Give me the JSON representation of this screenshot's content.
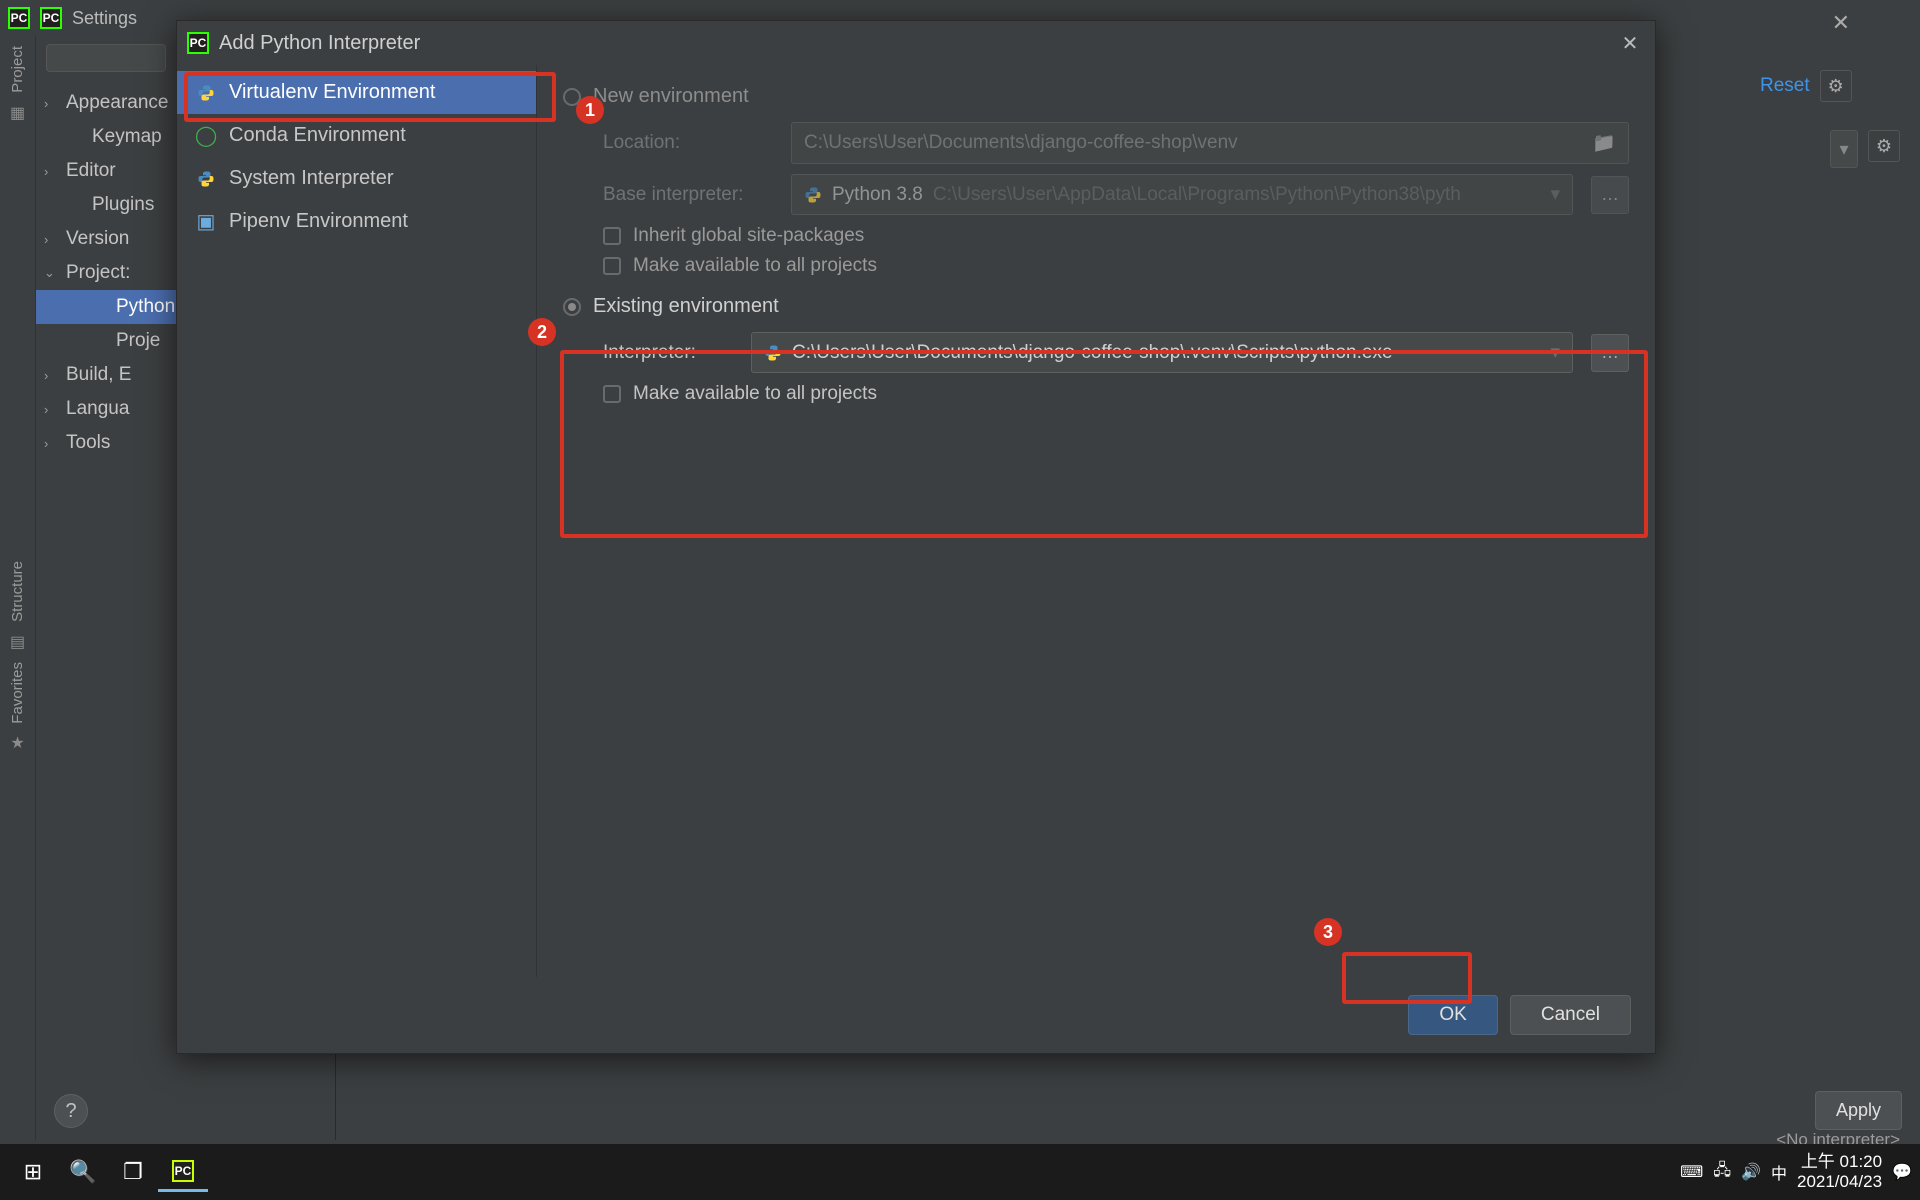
{
  "ide": {
    "titlebar_settings": "Settings",
    "reset": "Reset",
    "apply": "Apply",
    "no_interpreter": "<No interpreter>",
    "search_placeholder": ""
  },
  "settings_tree": {
    "items": [
      {
        "label": "Appearance",
        "chevron": ">"
      },
      {
        "label": "Keymap",
        "chevron": ""
      },
      {
        "label": "Editor",
        "chevron": ">"
      },
      {
        "label": "Plugins",
        "chevron": ""
      },
      {
        "label": "Version",
        "chevron": ">"
      },
      {
        "label": "Project:",
        "chevron": "v"
      },
      {
        "label": "Python",
        "chevron": "",
        "selected": true,
        "indent": true
      },
      {
        "label": "Proje",
        "chevron": "",
        "indent": true
      },
      {
        "label": "Build, E",
        "chevron": ">"
      },
      {
        "label": "Langua",
        "chevron": ">"
      },
      {
        "label": "Tools",
        "chevron": ">"
      }
    ]
  },
  "left_rail": {
    "project": "Project",
    "structure": "Structure",
    "favorites": "Favorites"
  },
  "dialog": {
    "title": "Add Python Interpreter",
    "side": [
      {
        "label": "Virtualenv Environment",
        "active": true,
        "icon": "python"
      },
      {
        "label": "Conda Environment",
        "icon": "conda"
      },
      {
        "label": "System Interpreter",
        "icon": "python"
      },
      {
        "label": "Pipenv Environment",
        "icon": "pipenv"
      }
    ],
    "new_env": {
      "label": "New environment",
      "location_label": "Location:",
      "location_value": "C:\\Users\\User\\Documents\\django-coffee-shop\\venv",
      "base_label": "Base interpreter:",
      "base_name": "Python 3.8",
      "base_path": "C:\\Users\\User\\AppData\\Local\\Programs\\Python\\Python38\\pyth",
      "inherit": "Inherit global site-packages",
      "make_avail": "Make available to all projects"
    },
    "existing_env": {
      "label": "Existing environment",
      "interp_label": "Interpreter:",
      "interp_value": "C:\\Users\\User\\Documents\\django-coffee-shop\\.venv\\Scripts\\python.exe",
      "make_avail": "Make available to all projects"
    },
    "ok": "OK",
    "cancel": "Cancel"
  },
  "callouts": {
    "a": "1",
    "b": "2",
    "c": "3"
  },
  "taskbar": {
    "ime": "中",
    "time": "上午 01:20",
    "date": "2021/04/23"
  }
}
